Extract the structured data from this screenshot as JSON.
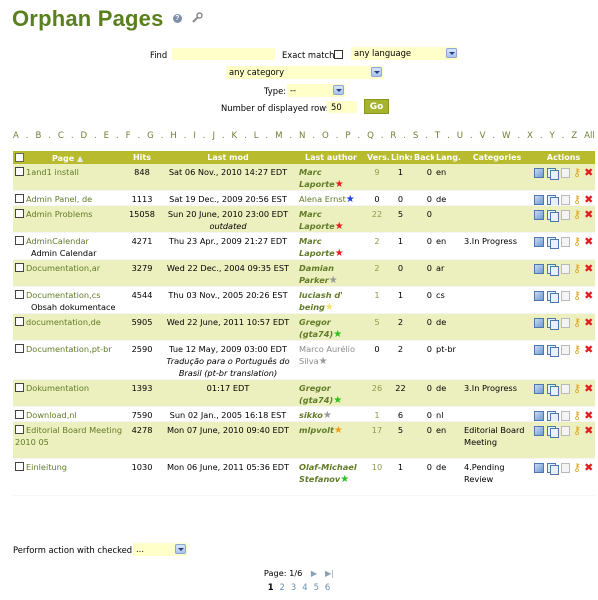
{
  "title": "Orphan Pages",
  "filters": {
    "find_label": "Find",
    "find_value": "",
    "exact_label": "Exact match",
    "language_value": "any language",
    "category_value": "any category",
    "type_label": "Type:",
    "type_value": "--",
    "rows_label": "Number of displayed rows",
    "rows_value": "50",
    "go_label": "Go"
  },
  "alphabet": [
    "A",
    "B",
    "C",
    "D",
    "E",
    "F",
    "G",
    "H",
    "I",
    "J",
    "K",
    "L",
    "M",
    "N",
    "O",
    "P",
    "Q",
    "R",
    "S",
    "T",
    "U",
    "V",
    "W",
    "X",
    "Y",
    "Z",
    "All"
  ],
  "columns": {
    "page": "Page",
    "hits": "Hits",
    "lastmod": "Last mod",
    "author": "Last author",
    "vers": "Vers.",
    "links": "Links",
    "backl": "Backl.",
    "lang": "Lang.",
    "categories": "Categories",
    "actions": "Actions"
  },
  "rows": [
    {
      "page": "1and1 install",
      "sub": "",
      "hits": "848",
      "lastmod": "Sat 06 Nov., 2010 14:27 EDT",
      "lastmod_note": "",
      "author": "Marc Laporte",
      "star_color": "#e51f1f",
      "vers": "9",
      "links": "1",
      "backl": "0",
      "lang": "en",
      "categories": ""
    },
    {
      "page": "Admin Panel, de",
      "sub": "",
      "hits": "1113",
      "lastmod": "Sat 19 Dec., 2009 20:56 EST",
      "lastmod_note": "",
      "author": "Alena Ernst",
      "star_color": "#1f3de5",
      "vers": "0",
      "links": "0",
      "backl": "0",
      "lang": "de",
      "categories": ""
    },
    {
      "page": "Admin Problems",
      "sub": "",
      "hits": "15058",
      "lastmod": "Sun 20 June, 2010 23:00 EDT",
      "lastmod_note": "outdated",
      "author": "Marc Laporte",
      "star_color": "#e51f1f",
      "vers": "22",
      "links": "5",
      "backl": "0",
      "lang": "",
      "categories": ""
    },
    {
      "page": "AdminCalendar",
      "sub": "Admin Calendar",
      "hits": "4271",
      "lastmod": "Thu 23 Apr., 2009 21:27 EDT",
      "lastmod_note": "",
      "author": "Marc Laporte",
      "star_color": "#e51f1f",
      "vers": "2",
      "links": "1",
      "backl": "0",
      "lang": "en",
      "categories": "3.In Progress"
    },
    {
      "page": "Documentation,ar",
      "sub": "",
      "hits": "3279",
      "lastmod": "Wed 22 Dec., 2004 09:35 EST",
      "lastmod_note": "",
      "author": "Damian Parker",
      "star_color": "#9a9a9a",
      "vers": "2",
      "links": "0",
      "backl": "0",
      "lang": "ar",
      "categories": ""
    },
    {
      "page": "Documentation,cs",
      "sub": "Obsah dokumentace",
      "hits": "4544",
      "lastmod": "Thu 03 Nov., 2005 20:26 EST",
      "lastmod_note": "",
      "author": "luciash d' being",
      "star_color": "#f0e06a",
      "vers": "1",
      "links": "1",
      "backl": "0",
      "lang": "cs",
      "categories": ""
    },
    {
      "page": "documentation,de",
      "sub": "",
      "hits": "5905",
      "lastmod": "Wed 22 June, 2011 10:57 EDT",
      "lastmod_note": "",
      "author": "Gregor (gta74)",
      "star_color": "#2fbf1f",
      "vers": "5",
      "links": "2",
      "backl": "0",
      "lang": "de",
      "categories": ""
    },
    {
      "page": "Documentation,pt-br",
      "sub": "",
      "hits": "2590",
      "lastmod": "Tue 12 May, 2009 03:00 EDT",
      "lastmod_note": "Tradução para o Português do Brasil (pt-br translation)",
      "author": "Marco Aurélio Silva",
      "star_color": "#9a9a9a",
      "vers": "0",
      "links": "2",
      "backl": "0",
      "lang": "pt-br",
      "categories": ""
    },
    {
      "page": "Dokumentation",
      "sub": "",
      "hits": "1393",
      "lastmod": "01:17 EDT",
      "lastmod_note": "",
      "author": "Gregor (gta74)",
      "star_color": "#2fbf1f",
      "vers": "26",
      "links": "22",
      "backl": "0",
      "lang": "de",
      "categories": "3.In Progress"
    },
    {
      "page": "Download,nl",
      "sub": "",
      "hits": "7590",
      "lastmod": "Sun 02 Jan., 2005 16:18 EST",
      "lastmod_note": "",
      "author": "sikko",
      "star_color": "#9a9a9a",
      "vers": "1",
      "links": "6",
      "backl": "0",
      "lang": "nl",
      "categories": ""
    },
    {
      "page": "Editorial Board Meeting 2010 05",
      "sub": "",
      "hits": "4278",
      "lastmod": "Mon 07 June, 2010 09:40 EDT",
      "lastmod_note": "",
      "author": "mlpvolt",
      "star_color": "#f0a020",
      "vers": "17",
      "links": "5",
      "backl": "0",
      "lang": "en",
      "categories": "Editorial Board Meeting"
    },
    {
      "page": "Einleitung",
      "sub": "",
      "hits": "1030",
      "lastmod": "Mon 06 June, 2011 05:36 EDT",
      "lastmod_note": "",
      "author": "Olaf-Michael Stefanov",
      "star_color": "#2fbf1f",
      "vers": "10",
      "links": "1",
      "backl": "0",
      "lang": "de",
      "categories": "4.Pending Review"
    }
  ],
  "bulk": {
    "label": "Perform action with checked:",
    "value": "..."
  },
  "pager": {
    "text": "Page: 1/6",
    "pages": [
      "1",
      "2",
      "3",
      "4",
      "5",
      "6"
    ]
  }
}
